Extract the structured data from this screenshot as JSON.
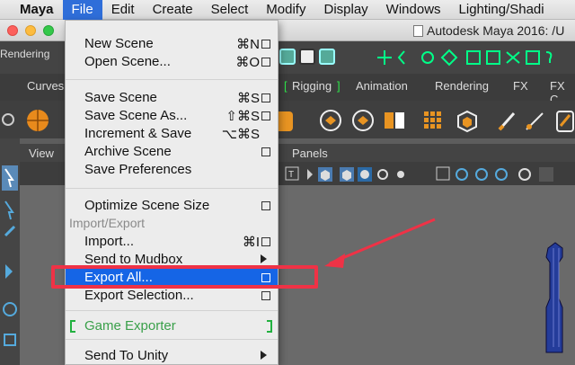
{
  "menubar": {
    "app": "Maya",
    "items": [
      "File",
      "Edit",
      "Create",
      "Select",
      "Modify",
      "Display",
      "Windows",
      "Lighting/Shadi"
    ]
  },
  "window": {
    "title": "Autodesk Maya 2016: /U"
  },
  "menuset": "Rendering",
  "tabs": {
    "curves": "Curves",
    "rigging": "Rigging",
    "animation": "Animation",
    "rendering": "Rendering",
    "fx": "FX",
    "fx_caching": "FX C"
  },
  "panel": {
    "view": "View",
    "panels": "Panels"
  },
  "file_menu": {
    "items": [
      {
        "label": "New Scene",
        "shortcut": "⌘N"
      },
      {
        "label": "Open Scene...",
        "shortcut": "⌘O"
      },
      {
        "label": "Save Scene",
        "shortcut": "⌘S"
      },
      {
        "label": "Save Scene As...",
        "shortcut": "⇧⌘S"
      },
      {
        "label": "Increment & Save",
        "shortcut": "⌥⌘S"
      },
      {
        "label": "Archive Scene"
      },
      {
        "label": "Save Preferences"
      },
      {
        "label": "Optimize Scene Size"
      },
      {
        "label": "Import/Export"
      },
      {
        "label": "Import...",
        "shortcut": "⌘I"
      },
      {
        "label": "Send to Mudbox"
      },
      {
        "label": "Export All..."
      },
      {
        "label": "Export Selection..."
      },
      {
        "label": "Game Exporter"
      },
      {
        "label": "Send To Unity"
      }
    ]
  },
  "colors": {
    "menu_highlight": "#1565e6",
    "annotation": "#ef3246",
    "game_exporter": "#3aa04a"
  }
}
